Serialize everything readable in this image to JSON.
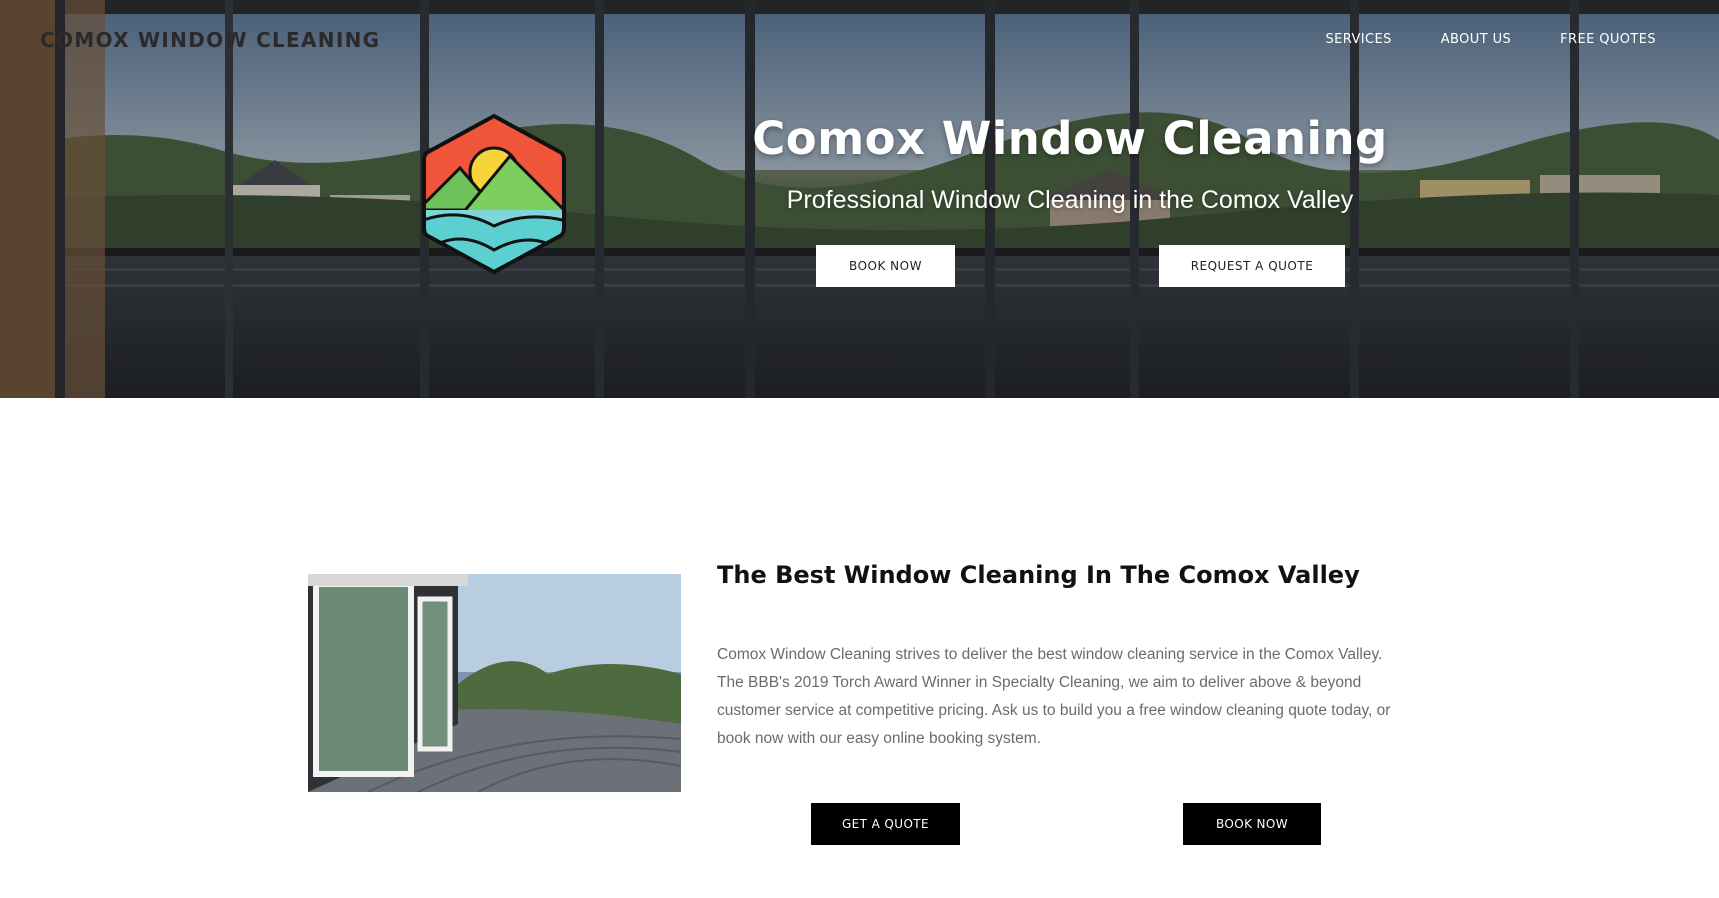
{
  "header": {
    "brand": "COMOX WINDOW CLEANING",
    "nav": [
      "SERVICES",
      "ABOUT US",
      "FREE QUOTES"
    ]
  },
  "hero": {
    "title": "Comox Window Cleaning",
    "subtitle": "Professional Window Cleaning in the Comox Valley",
    "book_label": "BOOK NOW",
    "quote_label": "REQUEST A QUOTE"
  },
  "intro": {
    "title": "The Best Window Cleaning In The Comox Valley",
    "body": "Comox Window Cleaning strives to deliver the best window cleaning service in the Comox Valley. The BBB's 2019 Torch Award Winner in Specialty Cleaning, we aim to deliver above & beyond customer service at competitive pricing. Ask us to build you a free window cleaning quote today, or book now with our easy online booking system.",
    "quote_label": "GET A QUOTE",
    "book_label": "BOOK NOW"
  },
  "colors": {
    "button_dark": "#000000",
    "button_light": "#ffffff",
    "body_text": "#6b6b6b"
  }
}
